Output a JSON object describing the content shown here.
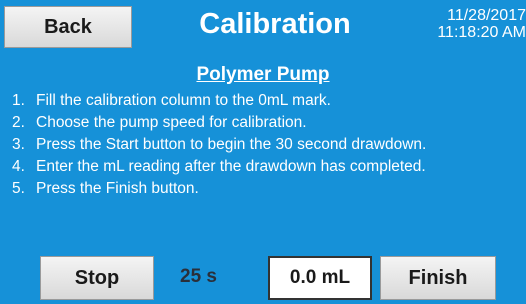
{
  "header": {
    "back_label": "Back",
    "title": "Calibration",
    "date": "11/28/2017",
    "time": "11:18:20 AM"
  },
  "main": {
    "subtitle": "Polymer Pump",
    "steps": [
      {
        "num": "1.",
        "text": "Fill the calibration column to the 0mL mark."
      },
      {
        "num": "2.",
        "text": "Choose the pump speed for calibration."
      },
      {
        "num": "3.",
        "text": "Press the Start button to begin the 30 second drawdown."
      },
      {
        "num": "4.",
        "text": "Enter the mL reading after the drawdown has completed."
      },
      {
        "num": "5.",
        "text": "Press the Finish button."
      }
    ]
  },
  "footer": {
    "stop_label": "Stop",
    "timer": "25 s",
    "reading_value": "0.0 mL",
    "finish_label": "Finish"
  },
  "colors": {
    "background": "#1691d8",
    "button": "#e6e6e6",
    "timer_text": "#2a2f3a"
  }
}
